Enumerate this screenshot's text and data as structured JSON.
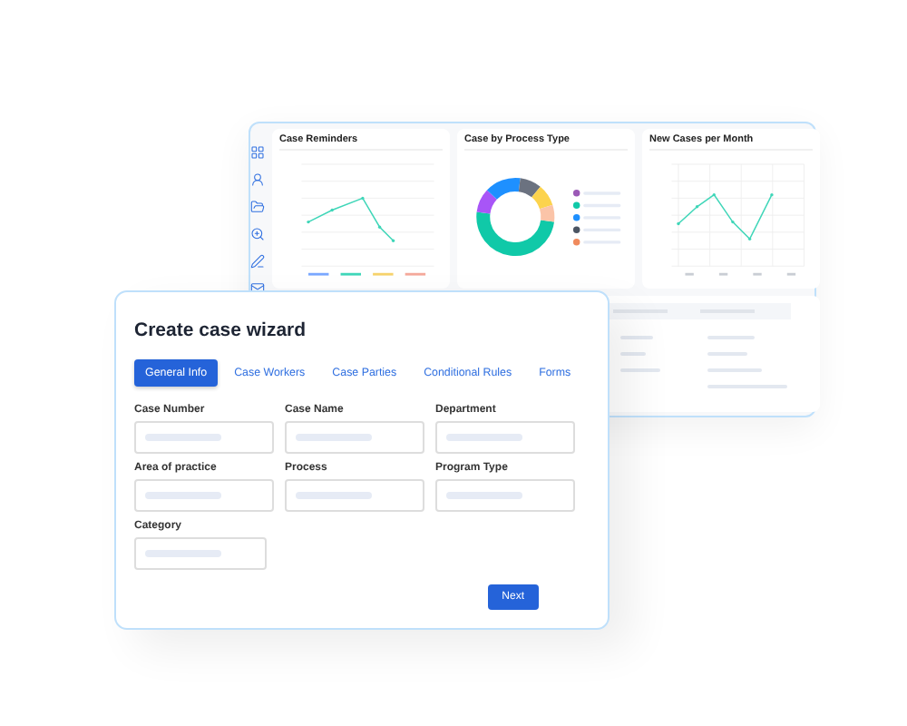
{
  "dashboard": {
    "cards": [
      {
        "kind": "line",
        "title": "Case Reminders"
      },
      {
        "kind": "donut",
        "title": "Case by Process Type"
      },
      {
        "kind": "line2",
        "title": "New Cases per Month"
      }
    ]
  },
  "wizard": {
    "title": "Create case wizard",
    "tabs": [
      {
        "label": "General Info",
        "selected": true
      },
      {
        "label": "Case Workers",
        "selected": false
      },
      {
        "label": "Case Parties",
        "selected": false
      },
      {
        "label": "Conditional Rules",
        "selected": false
      },
      {
        "label": "Forms",
        "selected": false
      }
    ],
    "fields": [
      {
        "label": "Case Number"
      },
      {
        "label": "Case Name"
      },
      {
        "label": "Department"
      },
      {
        "label": "Area of practice"
      },
      {
        "label": "Process"
      },
      {
        "label": "Program Type"
      },
      {
        "label": "Category"
      }
    ],
    "next_button": "Next"
  }
}
